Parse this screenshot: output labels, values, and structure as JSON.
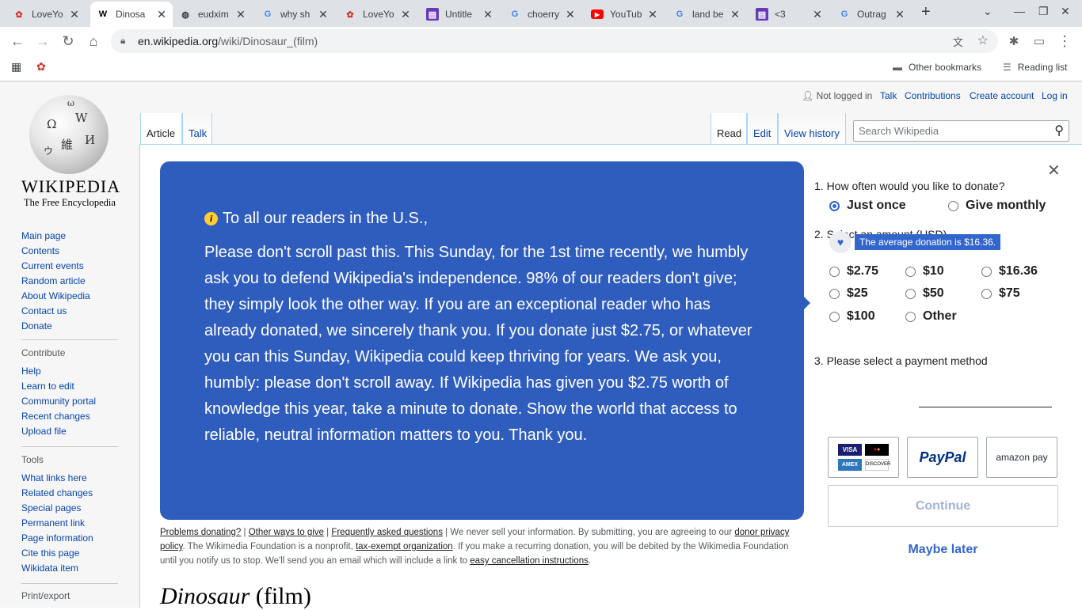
{
  "browser": {
    "tabs": [
      {
        "title": "LoveYo",
        "icon": "bear-icon",
        "color": "#d93025"
      },
      {
        "title": "Dinosa",
        "icon": "wikipedia-icon",
        "color": "#000000",
        "active": true
      },
      {
        "title": "eudxim",
        "icon": "globe-icon",
        "color": "#3c4043"
      },
      {
        "title": "why sh",
        "icon": "google-icon",
        "color": "#4285f4"
      },
      {
        "title": "LoveYo",
        "icon": "bear-icon",
        "color": "#d93025"
      },
      {
        "title": "Untitle",
        "icon": "forms-icon",
        "color": "#673ab7"
      },
      {
        "title": "choerry",
        "icon": "google-icon",
        "color": "#4285f4"
      },
      {
        "title": "YouTub",
        "icon": "youtube-icon",
        "color": "#ff0000"
      },
      {
        "title": "land be",
        "icon": "google-icon",
        "color": "#4285f4"
      },
      {
        "title": "<3",
        "icon": "forms-icon",
        "color": "#673ab7"
      },
      {
        "title": "Outrag",
        "icon": "google-icon",
        "color": "#4285f4"
      }
    ],
    "url_host": "en.wikipedia.org",
    "url_path": "/wiki/Dinosaur_(film)",
    "bookmarks": {
      "other": "Other bookmarks",
      "reading": "Reading list"
    }
  },
  "wiki": {
    "wordmark": "WIKIPEDIA",
    "tagline": "The Free Encyclopedia",
    "nav": [
      "Main page",
      "Contents",
      "Current events",
      "Random article",
      "About Wikipedia",
      "Contact us",
      "Donate"
    ],
    "contribute": {
      "heading": "Contribute",
      "items": [
        "Help",
        "Learn to edit",
        "Community portal",
        "Recent changes",
        "Upload file"
      ]
    },
    "tools": {
      "heading": "Tools",
      "items": [
        "What links here",
        "Related changes",
        "Special pages",
        "Permanent link",
        "Page information",
        "Cite this page",
        "Wikidata item"
      ]
    },
    "print": {
      "heading": "Print/export"
    },
    "user": {
      "status": "Not logged in",
      "talk": "Talk",
      "contributions": "Contributions",
      "create": "Create account",
      "login": "Log in"
    },
    "tabs": {
      "article": "Article",
      "talk": "Talk",
      "read": "Read",
      "edit": "Edit",
      "history": "View history"
    },
    "search_placeholder": "Search Wikipedia",
    "article_title_italic": "Dinosaur",
    "article_title_rest": " (film)"
  },
  "banner": {
    "greeting": "To all our readers in the U.S.,",
    "appeal": "Please don't scroll past this. This Sunday, for the 1st time recently, we humbly ask you to defend Wikipedia's independence. 98% of our readers don't give; they simply look the other way. If you are an exceptional reader who has already donated, we sincerely thank you. If you donate just $2.75, or whatever you can this Sunday, Wikipedia could keep thriving for years. We ask you, humbly: please don't scroll away. If Wikipedia has given you $2.75 worth of knowledge this year, take a minute to donate. Show the world that access to reliable, neutral information matters to you. Thank you.",
    "footer": {
      "problems": "Problems donating?",
      "other_ways": "Other ways to give",
      "faq": "Frequently asked questions",
      "text1": " | We never sell your information. By submitting, you are agreeing to our ",
      "donor_privacy": "donor privacy policy",
      "text2": ". The Wikimedia Foundation is a nonprofit, ",
      "tax": "tax-exempt organization",
      "text3": ". If you make a recurring donation, you will be debited by the Wikimedia Foundation until you notify us to stop. We'll send you an email which will include a link to ",
      "cancel": "easy cancellation instructions",
      "text4": "."
    }
  },
  "form": {
    "q1": "1.  How often would you like to donate?",
    "once": "Just once",
    "monthly": "Give monthly",
    "q2": "2.  Select an amount (USD)",
    "average": "The average donation is $16.36.",
    "amounts": [
      "$2.75",
      "$10",
      "$16.36",
      "$25",
      "$50",
      "$75",
      "$100",
      "Other"
    ],
    "q3": "3.  Please select a payment method",
    "cards": {
      "visa": "VISA",
      "mc": "MC",
      "amex": "AMEX",
      "discover": "DISCOVER"
    },
    "paypal": "PayPal",
    "amazon": "amazon pay",
    "continue": "Continue",
    "maybe": "Maybe later"
  }
}
